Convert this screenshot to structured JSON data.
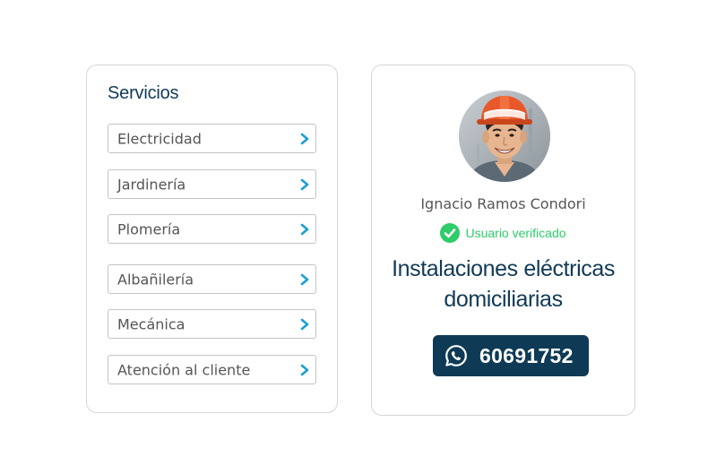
{
  "services": {
    "title": "Servicios",
    "items": [
      {
        "label": "Electricidad",
        "icon": "chevron-right-icon"
      },
      {
        "label": "Jardinería",
        "icon": "chevron-right-icon"
      },
      {
        "label": "Plomería",
        "icon": "chevron-right-icon"
      },
      {
        "label": "Albañilería",
        "icon": "chevron-right-icon"
      },
      {
        "label": "Mecánica",
        "icon": "chevron-right-icon"
      },
      {
        "label": "Atención al cliente",
        "icon": "chevron-right-icon"
      }
    ]
  },
  "profile": {
    "name": "Ignacio Ramos Condori",
    "verified_label": "Usuario verificado",
    "headline_line1": "Instalaciones eléctricas",
    "headline_line2": "domiciliarias",
    "phone": "60691752",
    "contact_icon": "whatsapp-icon",
    "avatar": "worker-photo"
  },
  "colors": {
    "brand_dark": "#113a57",
    "button_bg": "#0e3a55",
    "verified_green": "#2fcc6a",
    "chevron_blue": "#1a9fd6"
  }
}
